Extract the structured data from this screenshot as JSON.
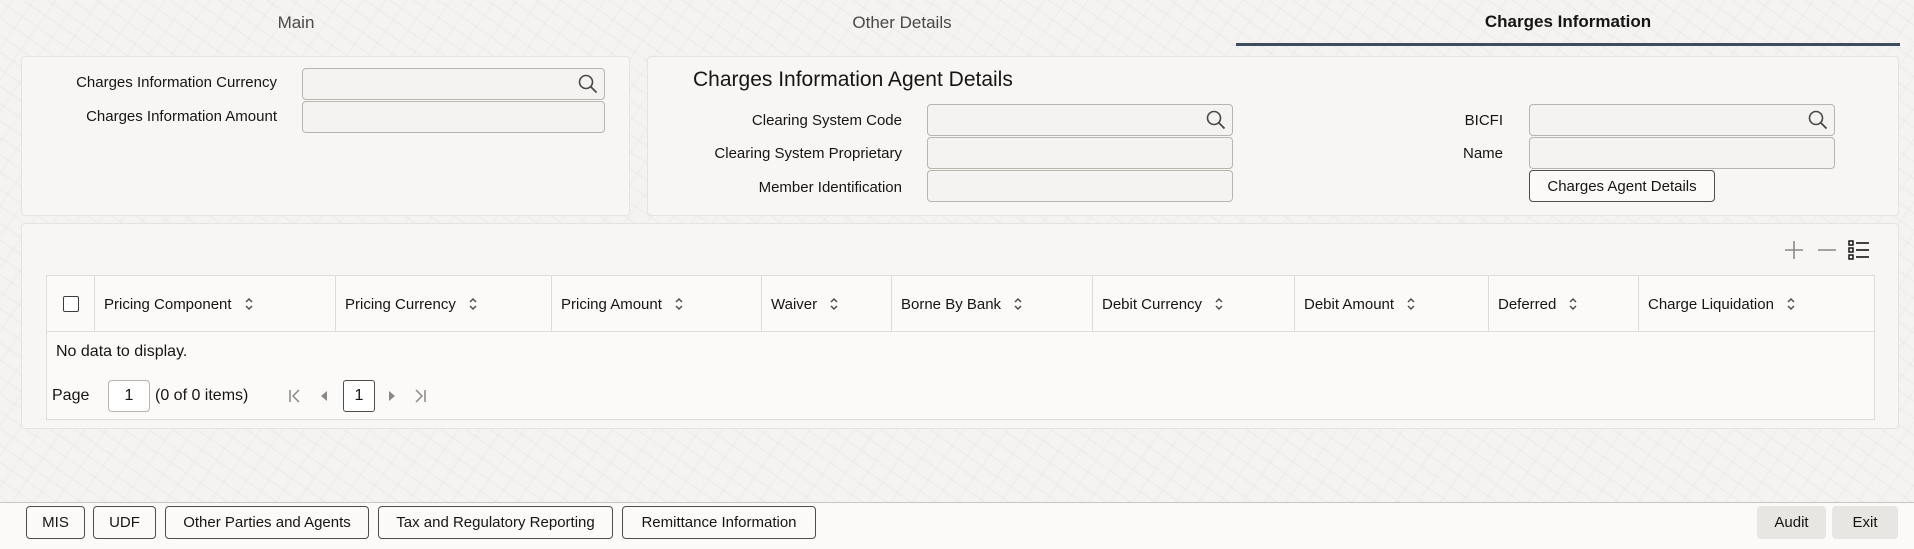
{
  "tabs": [
    {
      "label": "Main",
      "active": false
    },
    {
      "label": "Other Details",
      "active": false
    },
    {
      "label": "Charges Information",
      "active": true
    }
  ],
  "charges_info": {
    "currency_label": "Charges Information Currency",
    "currency_value": "",
    "amount_label": "Charges Information Amount",
    "amount_value": ""
  },
  "agent_details": {
    "title": "Charges Information Agent Details",
    "clearing_code_label": "Clearing System Code",
    "clearing_code_value": "",
    "clearing_proprietary_label": "Clearing System Proprietary",
    "clearing_proprietary_value": "",
    "member_id_label": "Member Identification",
    "member_id_value": "",
    "bicfi_label": "BICFI",
    "bicfi_value": "",
    "name_label": "Name",
    "name_value": "",
    "agent_button": "Charges Agent Details"
  },
  "grid": {
    "columns": [
      "Pricing Component",
      "Pricing Currency",
      "Pricing Amount",
      "Waiver",
      "Borne By Bank",
      "Debit Currency",
      "Debit Amount",
      "Deferred",
      "Charge Liquidation"
    ],
    "rows": [],
    "empty_text": "No data to display.",
    "pager": {
      "page_label": "Page",
      "page_value": "1",
      "items_text": "(0 of 0 items)",
      "current_page": "1"
    }
  },
  "footer": {
    "left_buttons": [
      "MIS",
      "UDF",
      "Other Parties and Agents",
      "Tax and Regulatory Reporting",
      "Remittance Information"
    ],
    "audit": "Audit",
    "exit": "Exit"
  },
  "icons": {
    "search": "search-icon",
    "add": "plus-icon",
    "remove": "minus-icon",
    "columns": "list-icon"
  },
  "colors": {
    "active_tab_underline": "#3d4d5e",
    "background": "#f4f3f2"
  }
}
